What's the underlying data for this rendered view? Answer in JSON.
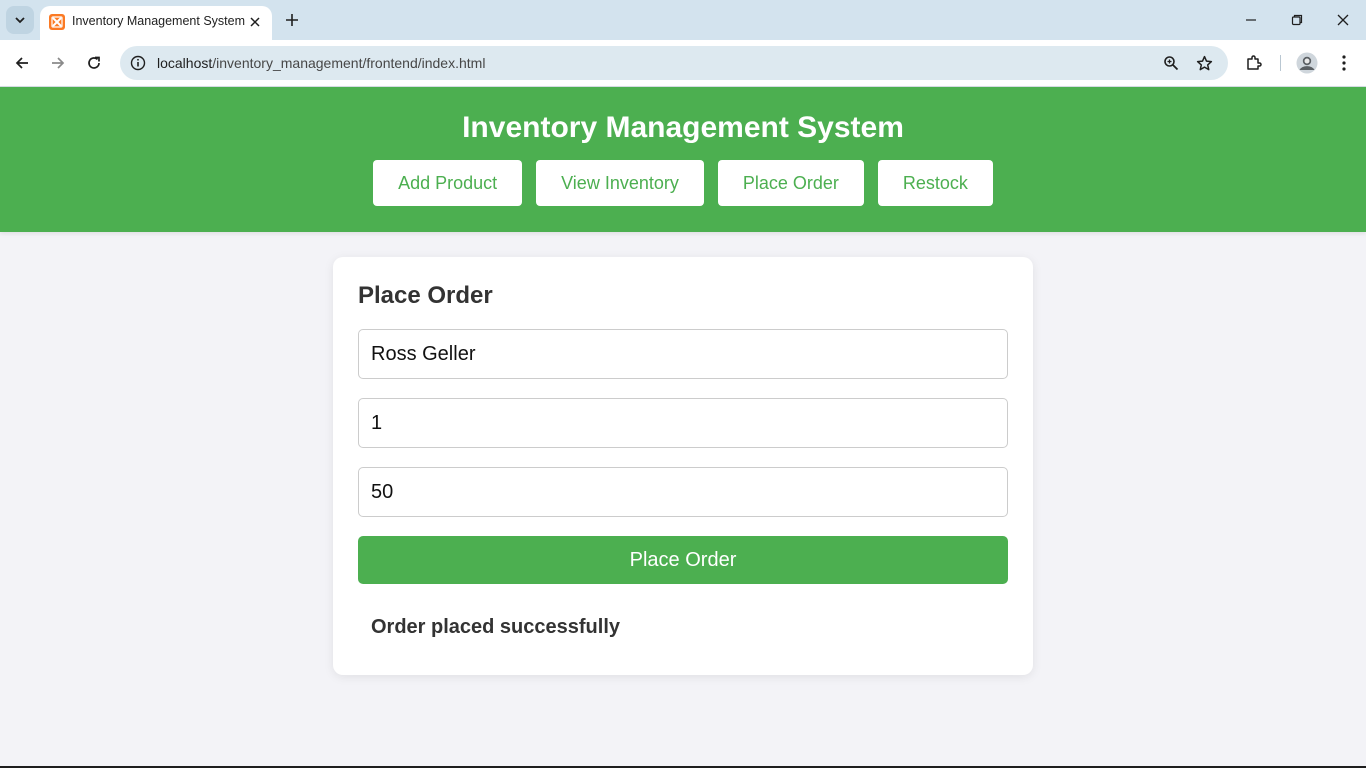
{
  "browser": {
    "tab_title": "Inventory Management System",
    "url_host": "localhost",
    "url_path": "/inventory_management/frontend/index.html",
    "accent_color": "#d3e3ee"
  },
  "app": {
    "title": "Inventory Management System",
    "brand_color": "#4caf50",
    "nav": [
      {
        "label": "Add Product"
      },
      {
        "label": "View Inventory"
      },
      {
        "label": "Place Order"
      },
      {
        "label": "Restock"
      }
    ]
  },
  "order_form": {
    "heading": "Place Order",
    "customer_name_value": "Ross Geller",
    "product_id_value": "1",
    "quantity_value": "50",
    "submit_label": "Place Order",
    "status_message": "Order placed successfully"
  },
  "icons": [
    "tab-list-icon",
    "xampp-favicon-icon",
    "close-icon",
    "plus-icon",
    "minimize-icon",
    "restore-icon",
    "window-close-icon",
    "back-arrow-icon",
    "forward-arrow-icon",
    "reload-icon",
    "site-info-icon",
    "zoom-icon",
    "star-icon",
    "extensions-icon",
    "profile-avatar-icon",
    "kebab-menu-icon"
  ]
}
